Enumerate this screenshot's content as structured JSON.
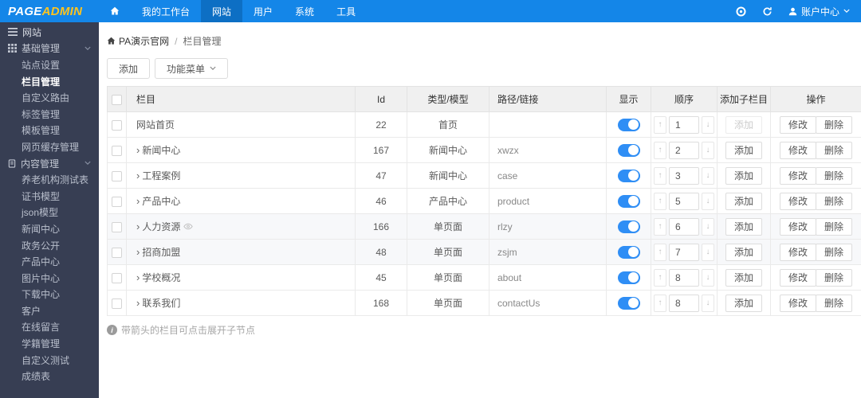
{
  "topbar": {
    "logo": {
      "part1": "PAGE",
      "part2": "ADMIN"
    },
    "nav_items": [
      "我的工作台",
      "网站",
      "用户",
      "系统",
      "工具"
    ],
    "active_nav": "网站",
    "account_label": "账户中心"
  },
  "sidebar": {
    "title": "网站",
    "group1": "基础管理",
    "group1_items": [
      "站点设置",
      "栏目管理",
      "自定义路由",
      "标签管理",
      "模板管理",
      "网页缓存管理"
    ],
    "active_item": "栏目管理",
    "group2": "内容管理",
    "group2_items": [
      "养老机构测试表",
      "证书模型",
      "json模型",
      "新闻中心",
      "政务公开",
      "产品中心",
      "图片中心",
      "下载中心",
      "客户",
      "在线留言",
      "学籍管理",
      "自定义测试",
      "成绩表"
    ]
  },
  "breadcrumb": {
    "site": "PA演示官网",
    "separator": "/",
    "page": "栏目管理"
  },
  "toolbar": {
    "add_label": "添加",
    "menu_label": "功能菜单"
  },
  "table": {
    "columns": {
      "name": "栏目",
      "id": "Id",
      "type": "类型/模型",
      "path": "路径/链接",
      "display": "显示",
      "order": "顺序",
      "add_child": "添加子栏目",
      "actions": "操作"
    },
    "action_labels": {
      "add": "添加",
      "edit": "修改",
      "delete": "删除"
    },
    "rows": [
      {
        "name": "网站首页",
        "id": "22",
        "type": "首页",
        "path": "",
        "visible": true,
        "order": "1",
        "expandable": false,
        "add_disabled": true
      },
      {
        "name": "新闻中心",
        "id": "167",
        "type": "新闻中心",
        "path": "xwzx",
        "visible": true,
        "order": "2",
        "expandable": true
      },
      {
        "name": "工程案例",
        "id": "47",
        "type": "新闻中心",
        "path": "case",
        "visible": true,
        "order": "3",
        "expandable": true
      },
      {
        "name": "产品中心",
        "id": "46",
        "type": "产品中心",
        "path": "product",
        "visible": true,
        "order": "5",
        "expandable": true
      },
      {
        "name": "人力资源",
        "id": "166",
        "type": "单页面",
        "path": "rlzy",
        "visible": true,
        "order": "6",
        "expandable": true,
        "hidden_marker": true
      },
      {
        "name": "招商加盟",
        "id": "48",
        "type": "单页面",
        "path": "zsjm",
        "visible": true,
        "order": "7",
        "expandable": true
      },
      {
        "name": "学校概况",
        "id": "45",
        "type": "单页面",
        "path": "about",
        "visible": true,
        "order": "8",
        "expandable": true
      },
      {
        "name": "联系我们",
        "id": "168",
        "type": "单页面",
        "path": "contactUs",
        "visible": true,
        "order": "8",
        "expandable": true
      }
    ]
  },
  "footnote": "带箭头的栏目可点击展开子节点",
  "colors": {
    "topbar_blue": "#1486e8",
    "active_nav_blue": "#0d6fc4",
    "logo_yellow": "#ffc41d",
    "sidebar_bg": "#373e53",
    "toggle_on": "#2f8ef5",
    "table_header_bg": "#f0f0f0"
  }
}
